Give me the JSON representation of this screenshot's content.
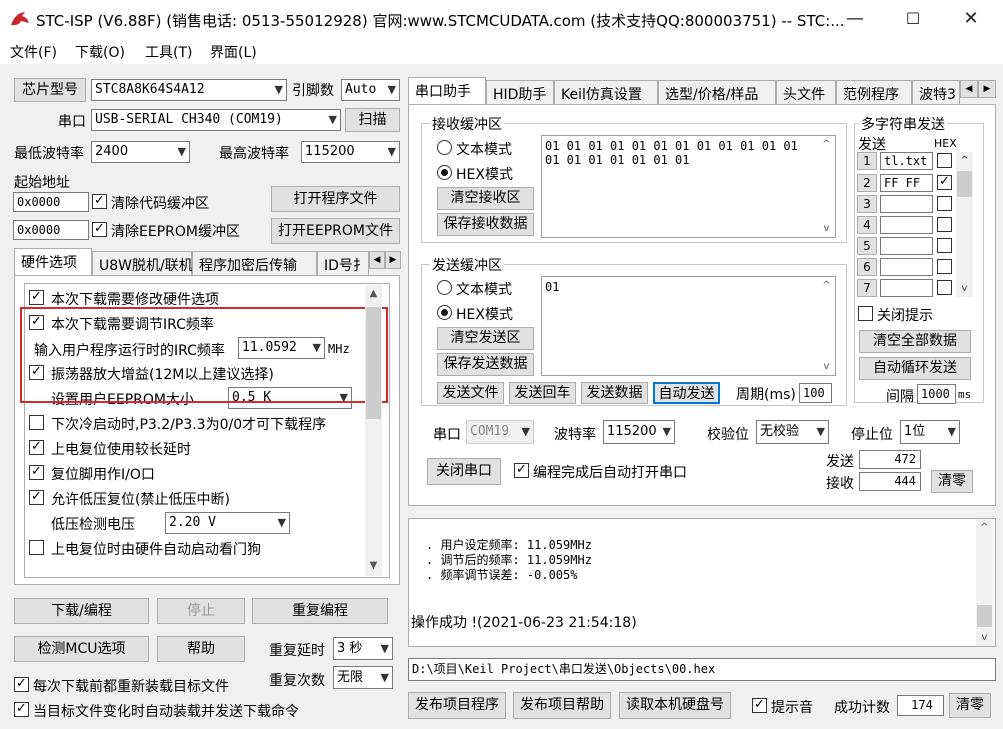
{
  "titlebar": {
    "title": "STC-ISP (V6.88F) (销售电话: 0513-55012928) 官网:www.STCMCUDATA.com  (技术支持QQ:800003751) -- STC:...",
    "min": "—",
    "max": "☐",
    "close": "✕"
  },
  "menu": {
    "file": "文件(F)",
    "download": "下载(O)",
    "tools": "工具(T)",
    "ui": "界面(L)"
  },
  "left": {
    "chip_btn": "芯片型号",
    "chip_value": "STC8A8K64S4A12",
    "pins_label": "引脚数",
    "pins_value": "Auto",
    "port_label": "串口",
    "port_value": "USB-SERIAL CH340 (COM19)",
    "scan_btn": "扫描",
    "min_baud_label": "最低波特率",
    "min_baud_value": "2400",
    "max_baud_label": "最高波特率",
    "max_baud_value": "115200",
    "start_addr_label": "起始地址",
    "addr1": "0x0000",
    "clear_code": "清除代码缓冲区",
    "open_prog": "打开程序文件",
    "addr2": "0x0000",
    "clear_eeprom": "清除EEPROM缓冲区",
    "open_eeprom": "打开EEPROM文件",
    "tabs": [
      "硬件选项",
      "U8W脱机/联机",
      "程序加密后传输",
      "ID号扌"
    ],
    "opts": {
      "o1": "本次下载需要修改硬件选项",
      "o2": "本次下载需要调节IRC频率",
      "irc_label": "输入用户程序运行时的IRC频率",
      "irc_value": "11.0592",
      "irc_unit": "MHz",
      "o3": "振荡器放大增益(12M以上建议选择)",
      "eeprom_label": "设置用户EEPROM大小",
      "eeprom_value": "0.5 K",
      "o4": "下次冷启动时,P3.2/P3.3为0/0才可下载程序",
      "o5": "上电复位使用较长延时",
      "o6": "复位脚用作I/O口",
      "o7": "允许低压复位(禁止低压中断)",
      "lv_label": "低压检测电压",
      "lv_value": "2.20 V",
      "o8": "上电复位时由硬件自动启动看门狗"
    },
    "download_btn": "下载/编程",
    "stop_btn": "停止",
    "reprog_btn": "重复编程",
    "check_mcu_btn": "检测MCU选项",
    "help_btn": "帮助",
    "repeat_delay_label": "重复延时",
    "repeat_delay_value": "3 秒",
    "repeat_count_label": "重复次数",
    "repeat_count_value": "无限",
    "reload_each": "每次下载前都重新装载目标文件",
    "auto_reload": "当目标文件变化时自动装载并发送下载命令"
  },
  "right": {
    "tabs": [
      "串口助手",
      "HID助手",
      "Keil仿真设置",
      "选型/价格/样品",
      "头文件",
      "范例程序",
      "波特3"
    ],
    "recv_title": "接收缓冲区",
    "text_mode": "文本模式",
    "hex_mode": "HEX模式",
    "clear_recv": "清空接收区",
    "save_recv": "保存接收数据",
    "recv_data": "01 01 01 01 01 01 01 01 01 01 01 01\n01 01 01 01 01 01 01",
    "send_title": "发送缓冲区",
    "clear_send": "清空发送区",
    "save_send": "保存发送数据",
    "send_data": "01",
    "send_file": "发送文件",
    "send_cr": "发送回车",
    "send_data_btn": "发送数据",
    "auto_send": "自动发送",
    "period_label": "周期(ms)",
    "period_value": "100",
    "multi_title": "多字符串发送",
    "send_col": "发送",
    "hex_col": "HEX",
    "rows": [
      {
        "n": "1",
        "v": "tl.txt",
        "hex": ""
      },
      {
        "n": "2",
        "v": "FF FF",
        "hex": "✓"
      },
      {
        "n": "3",
        "v": "",
        "hex": ""
      },
      {
        "n": "4",
        "v": "",
        "hex": ""
      },
      {
        "n": "5",
        "v": "",
        "hex": ""
      },
      {
        "n": "6",
        "v": "",
        "hex": ""
      },
      {
        "n": "7",
        "v": "",
        "hex": ""
      }
    ],
    "close_hint": "关闭提示",
    "clear_all": "清空全部数据",
    "auto_loop": "自动循环发送",
    "interval_label": "间隔",
    "interval_value": "1000",
    "interval_unit": "ms",
    "port_label": "串口",
    "port_value": "COM19",
    "baud_label": "波特率",
    "baud_value": "115200",
    "parity_label": "校验位",
    "parity_value": "无校验",
    "stop_label": "停止位",
    "stop_value": "1位",
    "close_port": "关闭串口",
    "auto_open": "编程完成后自动打开串口",
    "sent_label": "发送",
    "sent_value": "472",
    "recv_label": "接收",
    "recv_value": "444",
    "clear_btn": "清零",
    "log": [
      "用户设定频率: 11.059MHz",
      "调节后的频率: 11.059MHz",
      "频率调节误差: -0.005%"
    ],
    "log_success": "操作成功 !(2021-06-23 21:54:18)",
    "path": "D:\\项目\\Keil Project\\串口发送\\Objects\\00.hex",
    "publish_prog": "发布项目程序",
    "publish_help": "发布项目帮助",
    "read_disk": "读取本机硬盘号",
    "beep": "提示音",
    "success_count_label": "成功计数",
    "success_count_value": "174",
    "clear2": "清零"
  },
  "colors": {
    "highlight_box": "#d42a2a",
    "selected_border": "#0078d7"
  }
}
